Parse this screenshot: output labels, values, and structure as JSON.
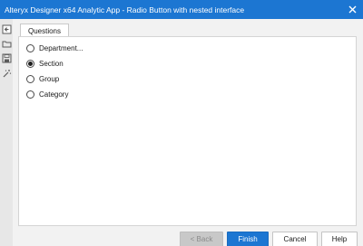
{
  "window": {
    "title": "Alteryx Designer x64 Analytic App - Radio Button with nested interface",
    "close_icon": "close-icon",
    "titlebar_color": "#1c76d2"
  },
  "toolbar": {
    "icons": [
      "app-icon",
      "folder-open-icon",
      "save-icon",
      "magic-wand-icon"
    ]
  },
  "tabs": [
    {
      "label": "Questions",
      "active": true
    }
  ],
  "questions": {
    "options": [
      {
        "label": "Department...",
        "selected": false
      },
      {
        "label": "Section",
        "selected": true
      },
      {
        "label": "Group",
        "selected": false
      },
      {
        "label": "Category",
        "selected": false
      }
    ]
  },
  "buttons": {
    "back": "< Back",
    "finish": "Finish",
    "cancel": "Cancel",
    "help": "Help"
  },
  "colors": {
    "accent": "#1c76d2",
    "disabled_button": "#c8c8c8"
  }
}
